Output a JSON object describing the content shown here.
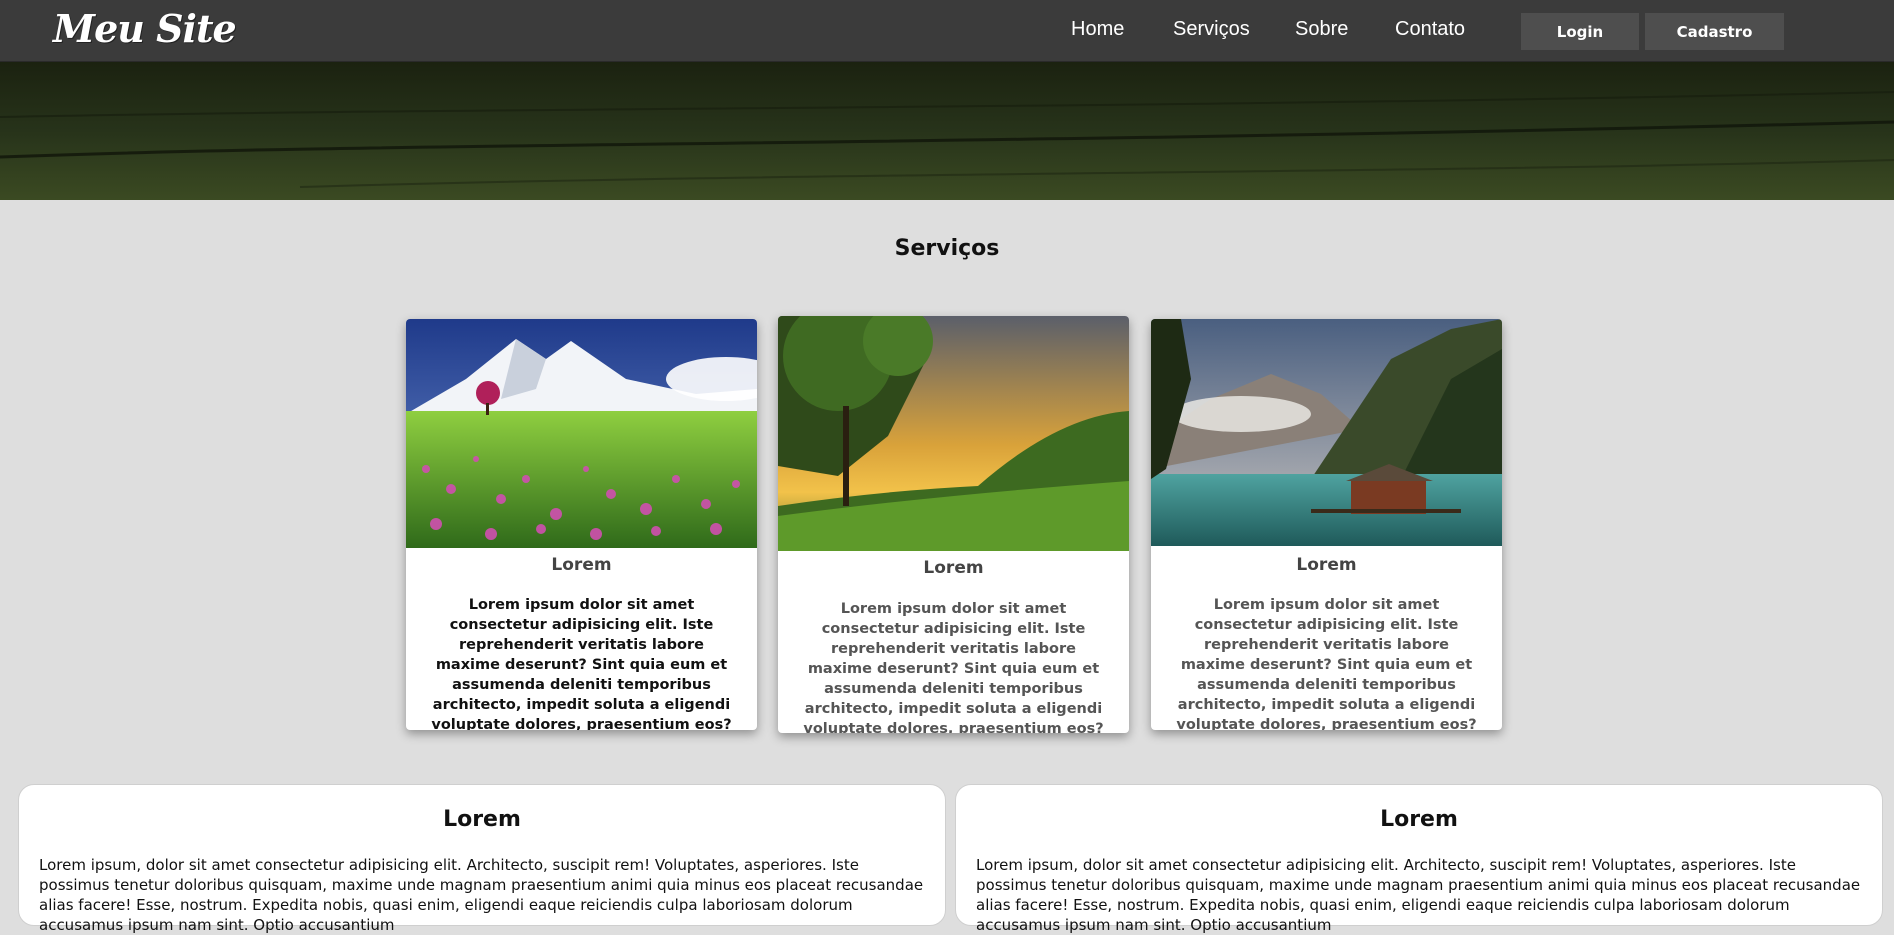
{
  "header": {
    "brand": "Meu Site",
    "nav": [
      "Home",
      "Serviços",
      "Sobre",
      "Contato"
    ],
    "login_label": "Login",
    "signup_label": "Cadastro"
  },
  "services": {
    "title": "Serviços",
    "cards": [
      {
        "title": "Lorem",
        "text": "Lorem ipsum dolor sit amet consectetur adipisicing elit. Iste reprehenderit veritatis labore maxime deserunt? Sint quia eum et assumenda deleniti temporibus architecto, impedit soluta a eligendi voluptate dolores, praesentium eos?",
        "text_color": "#111111",
        "image": "mountain-flower-meadow"
      },
      {
        "title": "Lorem",
        "text": "Lorem ipsum dolor sit amet consectetur adipisicing elit. Iste reprehenderit veritatis labore maxime deserunt? Sint quia eum et assumenda deleniti temporibus architecto, impedit soluta a eligendi voluptate dolores, praesentium eos?",
        "text_color": "#555555",
        "image": "sunset-forest-valley"
      },
      {
        "title": "Lorem",
        "text": "Lorem ipsum dolor sit amet consectetur adipisicing elit. Iste reprehenderit veritatis labore maxime deserunt? Sint quia eum et assumenda deleniti temporibus architecto, impedit soluta a eligendi voluptate dolores, praesentium eos?",
        "text_color": "#555555",
        "image": "mountain-lake-cabin"
      }
    ]
  },
  "panels": [
    {
      "title": "Lorem",
      "text": "Lorem ipsum, dolor sit amet consectetur adipisicing elit. Architecto, suscipit rem! Voluptates, asperiores. Iste possimus tenetur doloribus quisquam, maxime unde magnam praesentium animi quia minus eos placeat recusandae alias facere! Esse, nostrum. Expedita nobis, quasi enim, eligendi eaque reiciendis culpa laboriosam dolorum accusamus ipsum nam sint. Optio accusantium"
    },
    {
      "title": "Lorem",
      "text": "Lorem ipsum, dolor sit amet consectetur adipisicing elit. Architecto, suscipit rem! Voluptates, asperiores. Iste possimus tenetur doloribus quisquam, maxime unde magnam praesentium animi quia minus eos placeat recusandae alias facere! Esse, nostrum. Expedita nobis, quasi enim, eligendi eaque reiciendis culpa laboriosam dolorum accusamus ipsum nam sint. Optio accusantium"
    }
  ],
  "colors": {
    "header_bg": "#3b3b3b",
    "button_bg": "#4e4e4e",
    "page_bg": "#dedede"
  }
}
